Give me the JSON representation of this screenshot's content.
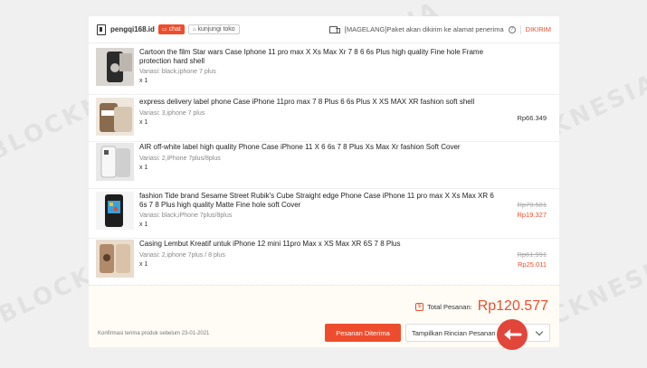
{
  "watermark": "BLOCKNESIA",
  "header": {
    "shop_name": "pengqi168.id",
    "chat_label": "chat",
    "visit_label": "kunjungi toko",
    "shipping_note": "[MAGELANG]Paket akan dikirim ke alamat penerima",
    "status": "DIKIRIM"
  },
  "items": [
    {
      "title": "Cartoon the film Star wars Case Iphone 11 pro max X Xs Max Xr 7 8 6 6s Plus high quality Fine hole Frame protection hard shell",
      "variant": "Variasi: black,iphone 7 plus",
      "qty": "x 1",
      "price_old": "",
      "price_new": ""
    },
    {
      "title": "express delivery label phone Case iPhone 11pro max 7 8 Plus 6 6s Plus X XS MAX XR fashion soft shell",
      "variant": "Variasi: 3,iphone 7 plus",
      "qty": "x 1",
      "price_old": "",
      "price_new": "Rp66.349"
    },
    {
      "title": "AIR off-white label high quality Phone Case iPhone 11 X 6 6s 7 8 Plus Xs Max Xr fashion Soft Cover",
      "variant": "Variasi: 2,iPhone 7plus/8plus",
      "qty": "x 1",
      "price_old": "",
      "price_new": ""
    },
    {
      "title": "fashion Tide brand Sesame Street Rubik's Cube Straight edge Phone Case iPhone 11 pro max X Xs Max XR 6 6s 7 8 Plus high quality Matte Fine hole soft Cover",
      "variant": "Variasi: black,iPhone 7plus/8plus",
      "qty": "x 1",
      "price_old": "Rp79.581",
      "price_new": "Rp19.327"
    },
    {
      "title": "Casing Lembut Kreatif untuk iPhone 12 mini 11pro Max x XS Max XR 6S 7 8 Plus",
      "variant": "Variasi: 2,iphone 7plus / 8 plus",
      "qty": "x 1",
      "price_old": "Rp61.991",
      "price_new": "Rp25.011"
    }
  ],
  "footer": {
    "total_label": "Total Pesanan:",
    "total_value": "Rp120.577",
    "confirm_note": "Konfirmasi terima produk sebelum 23-01-2021",
    "received_button": "Pesanan Diterima",
    "detail_button": "Tampilkan Rincian Pesanan"
  },
  "colors": {
    "accent": "#ee4d2d",
    "badge": "#e2453a"
  }
}
